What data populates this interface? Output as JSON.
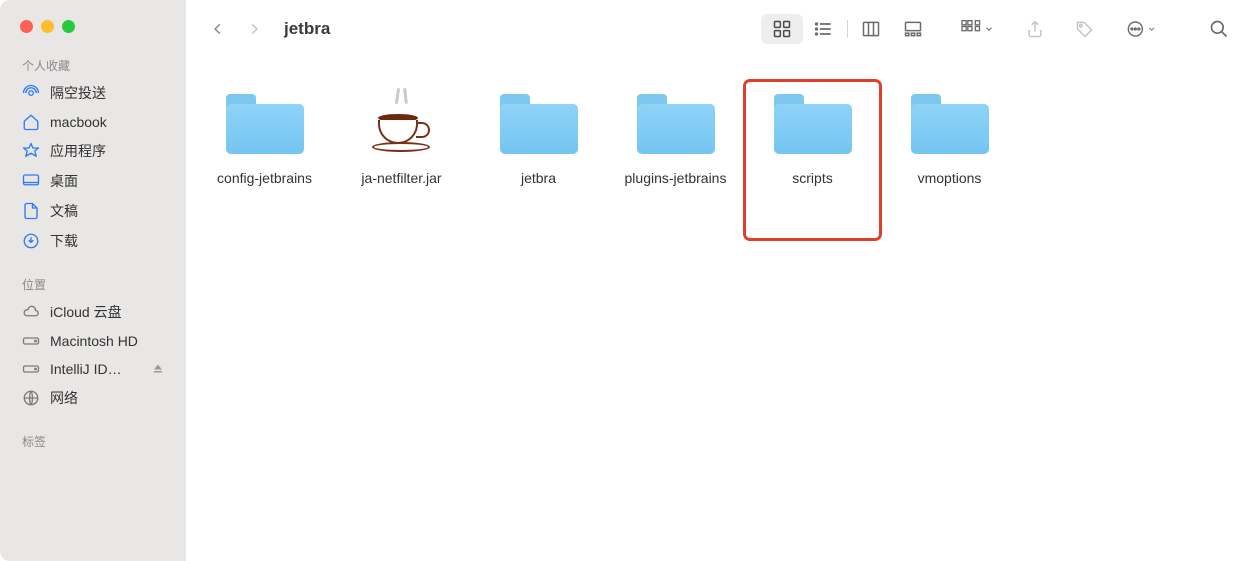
{
  "window": {
    "title": "jetbra"
  },
  "sidebar": {
    "sections": [
      {
        "header": "个人收藏",
        "items": [
          {
            "icon": "airdrop",
            "label": "隔空投送"
          },
          {
            "icon": "house",
            "label": "macbook"
          },
          {
            "icon": "appstore",
            "label": "应用程序"
          },
          {
            "icon": "desktop",
            "label": "桌面"
          },
          {
            "icon": "doc",
            "label": "文稿"
          },
          {
            "icon": "download",
            "label": "下载"
          }
        ]
      },
      {
        "header": "位置",
        "items": [
          {
            "icon": "cloud",
            "label": "iCloud 云盘",
            "gray": true
          },
          {
            "icon": "disk",
            "label": "Macintosh HD",
            "gray": true
          },
          {
            "icon": "disk",
            "label": "IntelliJ ID…",
            "gray": true,
            "eject": true
          },
          {
            "icon": "globe",
            "label": "网络",
            "gray": true
          }
        ]
      },
      {
        "header": "标签",
        "items": []
      }
    ]
  },
  "files": [
    {
      "name": "config-jetbrains",
      "type": "folder",
      "highlight": false
    },
    {
      "name": "ja-netfilter.jar",
      "type": "jar",
      "highlight": false
    },
    {
      "name": "jetbra",
      "type": "folder",
      "highlight": false
    },
    {
      "name": "plugins-jetbrains",
      "type": "folder",
      "highlight": false
    },
    {
      "name": "scripts",
      "type": "folder",
      "highlight": true
    },
    {
      "name": "vmoptions",
      "type": "folder",
      "highlight": false
    }
  ]
}
